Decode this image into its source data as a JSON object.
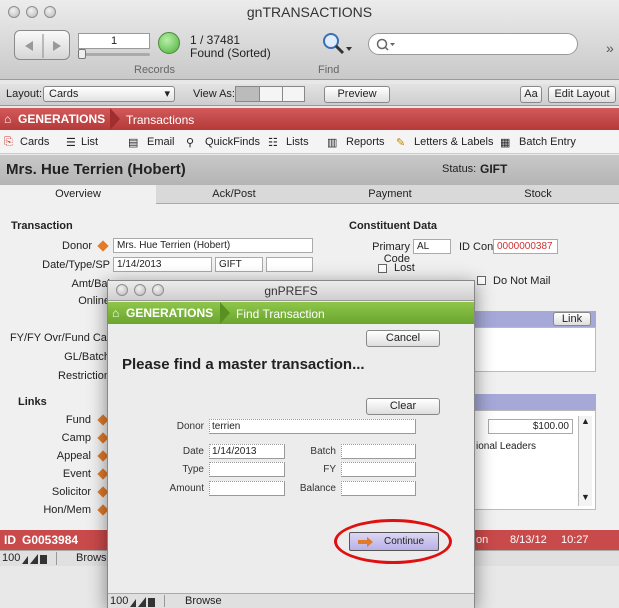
{
  "window": {
    "title": "gnTRANSACTIONS",
    "record_number": "1",
    "record_count": "1 / 37481",
    "found_status": "Found (Sorted)",
    "records_label": "Records",
    "find_label": "Find",
    "search_placeholder": ""
  },
  "layoutbar": {
    "layout_label": "Layout:",
    "layout_value": "Cards",
    "viewas_label": "View As:",
    "preview": "Preview",
    "aa": "Aa",
    "edit_layout": "Edit Layout"
  },
  "header": {
    "brand": "GENERATIONS",
    "section": "Transactions"
  },
  "nav": {
    "cards": "Cards",
    "list": "List",
    "email": "Email",
    "quickfinds": "QuickFinds",
    "lists": "Lists",
    "reports": "Reports",
    "letters": "Letters & Labels",
    "batch": "Batch Entry"
  },
  "record": {
    "name": "Mrs. Hue Terrien (Hobert)",
    "status_label": "Status:",
    "status_value": "GIFT"
  },
  "tabs": [
    "Overview",
    "Ack/Post",
    "Payment",
    "Stock"
  ],
  "transaction": {
    "heading": "Transaction",
    "donor_label": "Donor",
    "donor_value": "Mrs. Hue Terrien (Hobert)",
    "date_label": "Date/Type/SP",
    "date_value": "1/14/2013",
    "type_value": "GIFT",
    "amt_label": "Amt/Bal",
    "online_label": "Online",
    "fy_label": "FY/FY Ovr/Fund Cat",
    "gl_label": "GL/Batch",
    "restrictions_label": "Restriction"
  },
  "links": {
    "heading": "Links",
    "fund": "Fund",
    "camp": "Camp",
    "appeal": "Appeal",
    "event": "Event",
    "solicitor": "Solicitor",
    "honmem": "Hon/Mem"
  },
  "constituent": {
    "heading": "Constituent Data",
    "primary_code_label": "Primary Code",
    "primary_code_value": "AL",
    "idcon_label": "ID Con",
    "idcon_value": "0000000387",
    "lost_label": "Lost",
    "donotmail_label": "Do Not Mail",
    "link_button": "Link",
    "amount_value": "$100.00",
    "leaders_value": "ional Leaders"
  },
  "footer": {
    "id_label": "ID",
    "id_value": "G0053984",
    "partial": "on",
    "date": "8/13/12",
    "time": "10:27"
  },
  "statusbar": {
    "zoom": "100",
    "mode": "Browse"
  },
  "dialog": {
    "title": "gnPREFS",
    "brand": "GENERATIONS",
    "section": "Find Transaction",
    "cancel": "Cancel",
    "prompt": "Please find a master transaction...",
    "clear": "Clear",
    "donor_label": "Donor",
    "donor_value": "terrien",
    "date_label": "Date",
    "date_value": "1/14/2013",
    "batch_label": "Batch",
    "type_label": "Type",
    "fy_label": "FY",
    "amount_label": "Amount",
    "balance_label": "Balance",
    "continue": "Continue",
    "zoom": "100",
    "mode": "Browse"
  },
  "colors": {
    "brand_red": "#c94a4a",
    "brand_green": "#7ab53b",
    "accent_orange": "#e07b2c",
    "highlight_circle": "#e01010"
  }
}
